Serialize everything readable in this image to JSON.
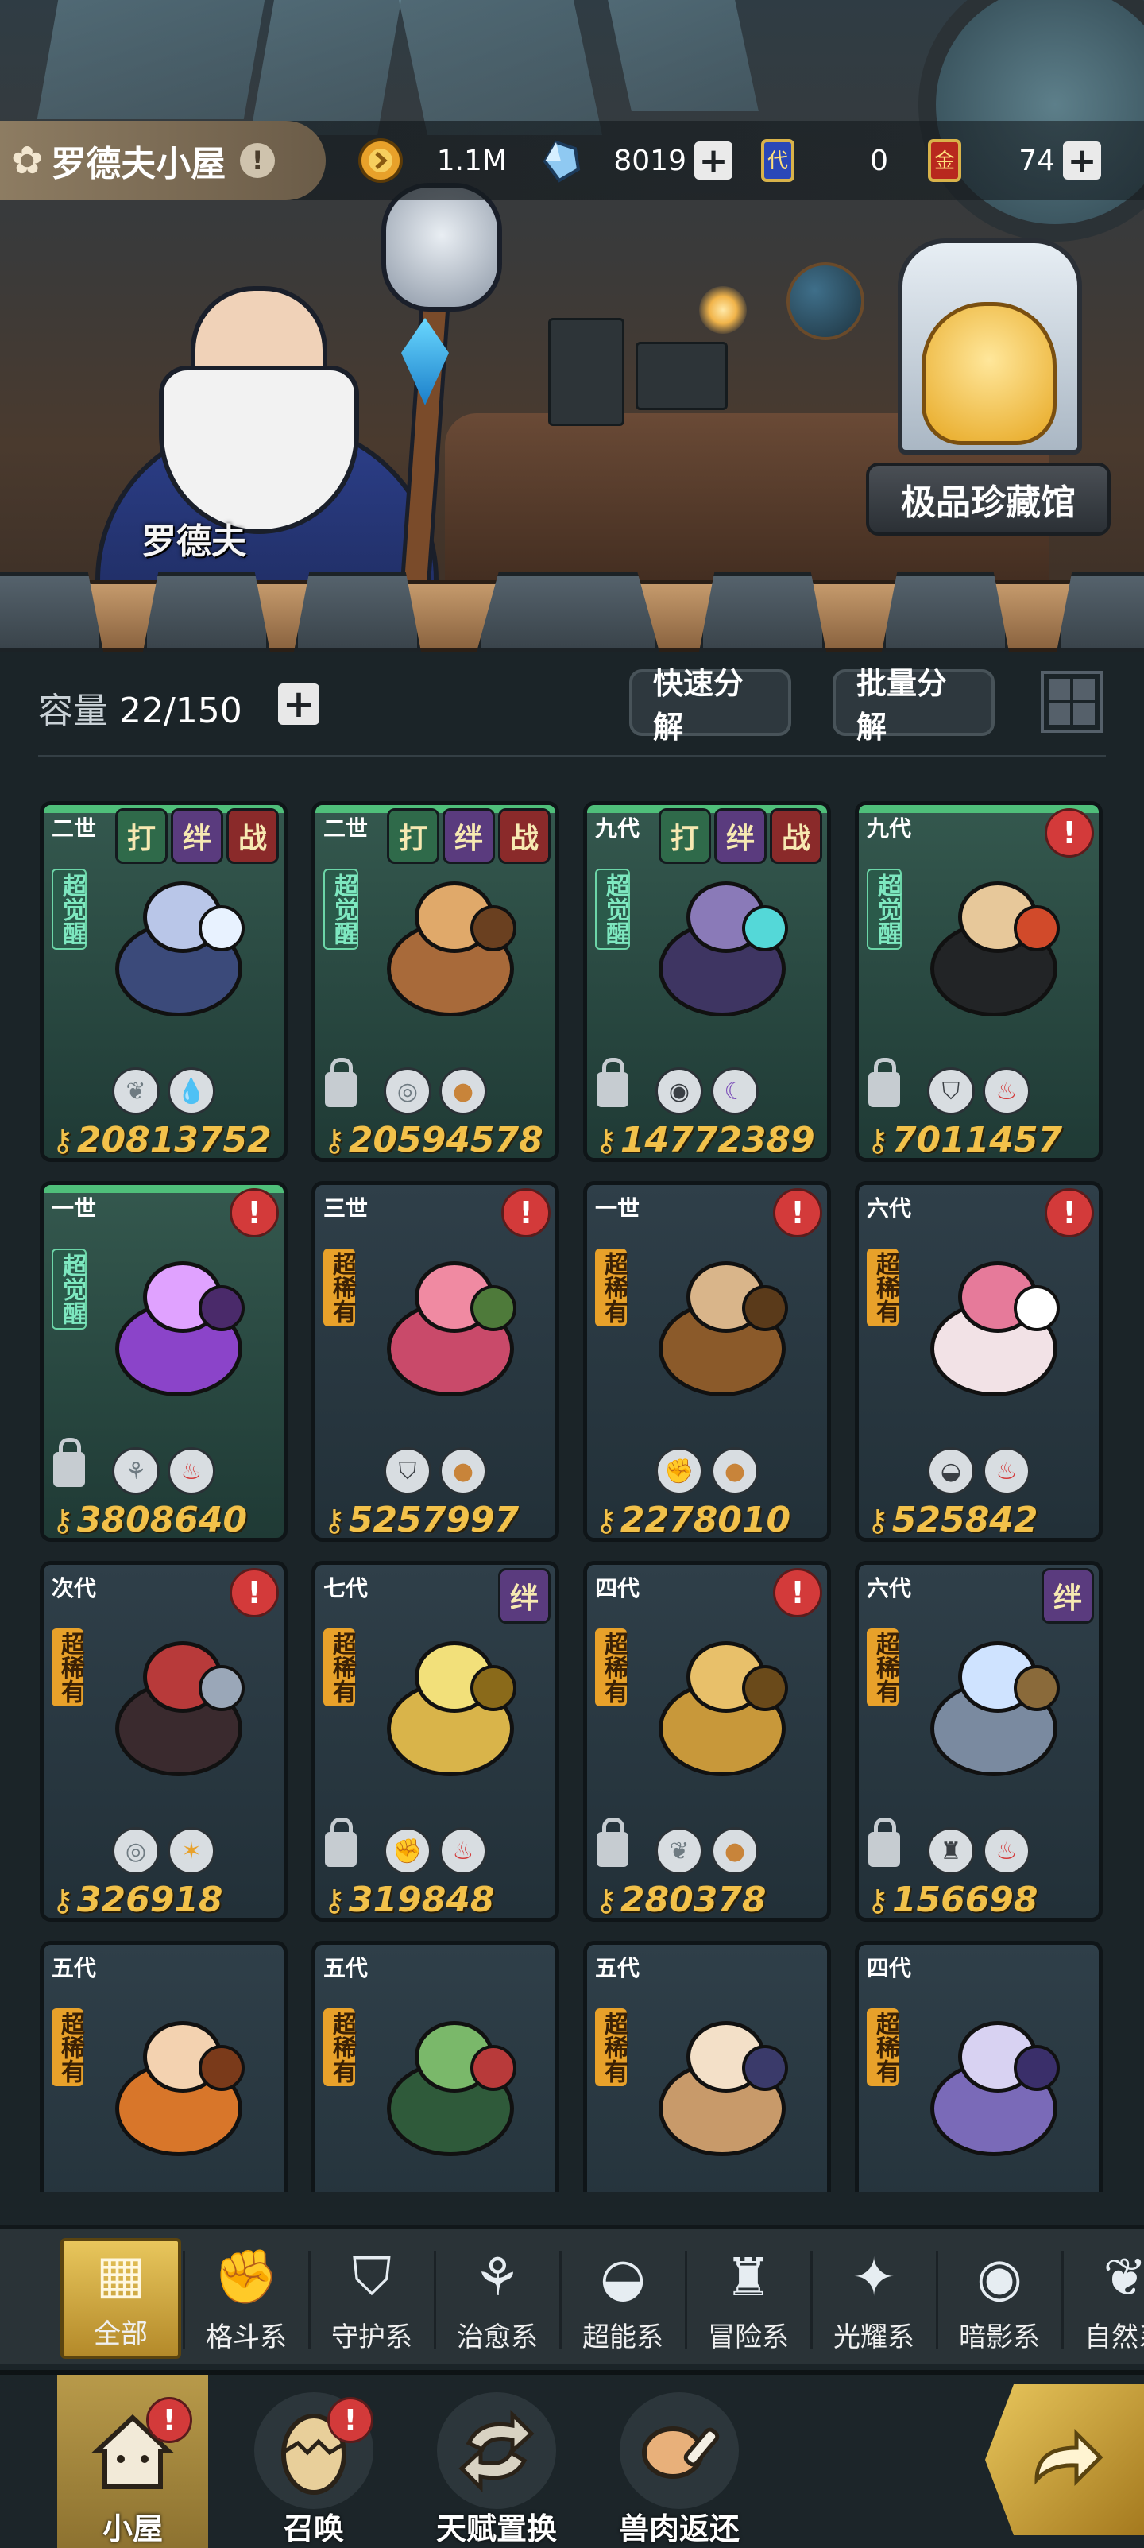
{
  "header": {
    "title": "罗德夫小屋",
    "wizard_name": "罗德夫",
    "museum_label": "极品珍藏馆"
  },
  "resources": {
    "coins": "1.1M",
    "crystals": "8019",
    "card_ticket": "0",
    "gold_ticket": "74"
  },
  "toolbar": {
    "capacity_label": "容量",
    "capacity_value": "22/150",
    "quick_decompose": "快速分解",
    "batch_decompose": "批量分解"
  },
  "cards": [
    {
      "gen": "二世",
      "rarity": "超觉醒",
      "awaken": true,
      "badges": [
        "打",
        "绊",
        "战"
      ],
      "alert": false,
      "lock": false,
      "types": [
        "leaf",
        "water"
      ],
      "power": "20813752"
    },
    {
      "gen": "二世",
      "rarity": "超觉醒",
      "awaken": true,
      "badges": [
        "打",
        "绊",
        "战"
      ],
      "alert": false,
      "lock": true,
      "types": [
        "swirl",
        "rock"
      ],
      "power": "20594578"
    },
    {
      "gen": "九代",
      "rarity": "超觉醒",
      "awaken": true,
      "badges": [
        "打",
        "绊",
        "战"
      ],
      "alert": false,
      "lock": true,
      "types": [
        "eye",
        "moon"
      ],
      "power": "14772389"
    },
    {
      "gen": "九代",
      "rarity": "超觉醒",
      "awaken": true,
      "badges": [],
      "alert": true,
      "lock": true,
      "types": [
        "shield",
        "fire"
      ],
      "power": "7011457"
    },
    {
      "gen": "一世",
      "rarity": "超觉醒",
      "awaken": true,
      "badges": [],
      "alert": true,
      "lock": true,
      "types": [
        "sprout",
        "fire"
      ],
      "power": "3808640"
    },
    {
      "gen": "三世",
      "rarity": "超稀有",
      "awaken": false,
      "badges": [],
      "alert": true,
      "lock": false,
      "types": [
        "shield",
        "rock"
      ],
      "power": "5257997"
    },
    {
      "gen": "一世",
      "rarity": "超稀有",
      "awaken": false,
      "badges": [],
      "alert": true,
      "lock": false,
      "types": [
        "fist",
        "rock"
      ],
      "power": "2278010"
    },
    {
      "gen": "六代",
      "rarity": "超稀有",
      "awaken": false,
      "badges": [],
      "alert": true,
      "lock": false,
      "types": [
        "alien",
        "fire"
      ],
      "power": "525842"
    },
    {
      "gen": "次代",
      "rarity": "超稀有",
      "awaken": false,
      "badges": [],
      "alert": true,
      "lock": false,
      "types": [
        "swirl",
        "star"
      ],
      "power": "326918"
    },
    {
      "gen": "七代",
      "rarity": "超稀有",
      "awaken": false,
      "badges": [
        "绊"
      ],
      "alert": false,
      "lock": true,
      "types": [
        "fist",
        "fire"
      ],
      "power": "319848"
    },
    {
      "gen": "四代",
      "rarity": "超稀有",
      "awaken": false,
      "badges": [],
      "alert": true,
      "lock": true,
      "types": [
        "leaf",
        "rock"
      ],
      "power": "280378"
    },
    {
      "gen": "六代",
      "rarity": "超稀有",
      "awaken": false,
      "badges": [
        "绊"
      ],
      "alert": false,
      "lock": true,
      "types": [
        "tower",
        "fire"
      ],
      "power": "156698"
    },
    {
      "gen": "五代",
      "rarity": "超稀有",
      "awaken": false,
      "badges": [],
      "alert": false,
      "lock": false,
      "types": [],
      "power": ""
    },
    {
      "gen": "五代",
      "rarity": "超稀有",
      "awaken": false,
      "badges": [],
      "alert": false,
      "lock": false,
      "types": [],
      "power": ""
    },
    {
      "gen": "五代",
      "rarity": "超稀有",
      "awaken": false,
      "badges": [],
      "alert": false,
      "lock": false,
      "types": [],
      "power": ""
    },
    {
      "gen": "四代",
      "rarity": "超稀有",
      "awaken": false,
      "badges": [],
      "alert": false,
      "lock": false,
      "types": [],
      "power": ""
    }
  ],
  "category_tabs": [
    {
      "label": "全部",
      "icon": "all-blocks-icon"
    },
    {
      "label": "格斗系",
      "icon": "fist-icon"
    },
    {
      "label": "守护系",
      "icon": "shield-icon"
    },
    {
      "label": "治愈系",
      "icon": "sprout-icon"
    },
    {
      "label": "超能系",
      "icon": "alien-icon"
    },
    {
      "label": "冒险系",
      "icon": "tower-icon"
    },
    {
      "label": "光耀系",
      "icon": "sparkle-icon"
    },
    {
      "label": "暗影系",
      "icon": "eye-icon"
    },
    {
      "label": "自然系",
      "icon": "leaf-icon"
    }
  ],
  "bottom_nav": [
    {
      "label": "小屋",
      "icon": "house-icon",
      "alert": "!"
    },
    {
      "label": "召唤",
      "icon": "egg-icon",
      "alert": "!"
    },
    {
      "label": "天赋置换",
      "icon": "exchange-icon",
      "alert": ""
    },
    {
      "label": "兽肉返还",
      "icon": "meat-icon",
      "alert": ""
    }
  ],
  "colors": {
    "accent_gold": "#e8c65c",
    "power_text": "#f2c14a",
    "alert_red": "#d33a3a",
    "bond_purple": "#5a3b7e"
  }
}
